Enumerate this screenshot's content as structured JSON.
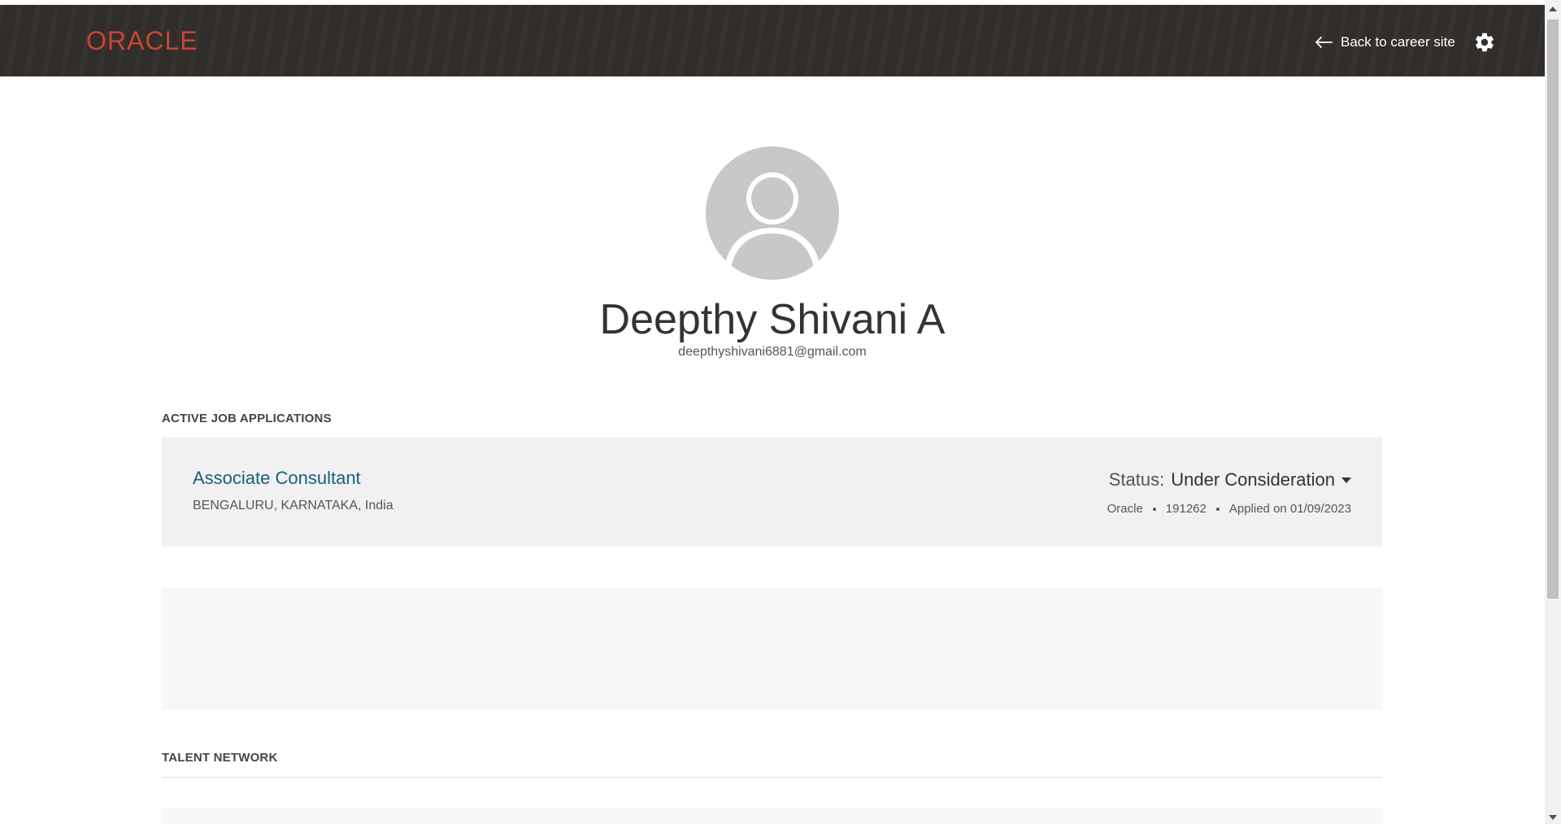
{
  "header": {
    "logo_text": "ORACLE",
    "back_label": "Back to career site",
    "brand_color": "#c74634",
    "back_icon": "arrow-left-icon",
    "settings_icon": "gear-icon"
  },
  "profile": {
    "name": "Deepthy Shivani A",
    "email": "deepthyshivani6881@gmail.com",
    "avatar_icon": "user-avatar-icon"
  },
  "applications": {
    "section_title": "ACTIVE JOB APPLICATIONS",
    "items": [
      {
        "title": "Associate Consultant",
        "location": "BENGALURU, KARNATAKA, India",
        "status_label": "Status:",
        "status_value": "Under Consideration",
        "company": "Oracle",
        "requisition": "191262",
        "applied": "Applied on 01/09/2023"
      }
    ]
  },
  "talent_network": {
    "section_title": "TALENT NETWORK"
  }
}
